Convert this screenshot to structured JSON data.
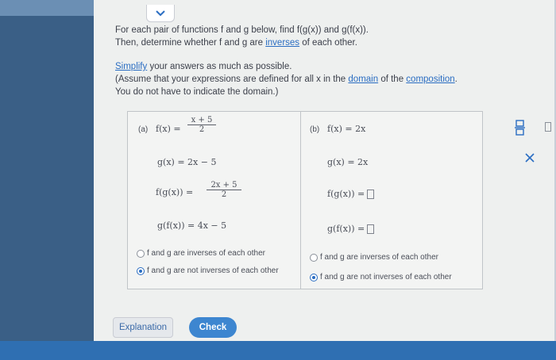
{
  "prompt": {
    "line1": "For each pair of functions f and g below, find f(g(x)) and g(f(x)).",
    "line2_pre": "Then, determine whether f and g are ",
    "line2_link": "inverses",
    "line2_post": " of each other.",
    "simplify_link": "Simplify",
    "simplify_rest": " your answers as much as possible.",
    "assume_pre": "(Assume that your expressions are defined for all x in the ",
    "domain_link": "domain",
    "assume_mid": " of the ",
    "composition_link": "composition",
    "assume_post": ".",
    "no_indicate": "You do not have to indicate the domain.)"
  },
  "part_a": {
    "label": "(a)",
    "f_lhs": "f(x) =",
    "f_num": "x + 5",
    "f_den": "2",
    "g_def": "g(x) = 2x − 5",
    "fg_lhs": "f(g(x)) =",
    "fg_num": "2x + 5",
    "fg_den": "2",
    "gf_def": "g(f(x)) = 4x − 5",
    "option_inverse": "f and g are inverses of each other",
    "option_not_inverse": "f and g are not inverses of each other",
    "selected": "not_inverse"
  },
  "part_b": {
    "label": "(b)",
    "f_def": "f(x) = 2x",
    "g_def": "g(x) = 2x",
    "fg_lhs": "f(g(x)) =",
    "gf_lhs": "g(f(x)) =",
    "option_inverse": "f and g are inverses of each other",
    "option_not_inverse": "f and g are not inverses of each other",
    "selected": "not_inverse"
  },
  "buttons": {
    "explanation": "Explanation",
    "check": "Check"
  },
  "icons": {
    "chevron": "chevron-down-icon",
    "fraction_tool": "fraction-tool-icon",
    "close": "close-icon"
  },
  "colors": {
    "accent": "#2a6dc2",
    "check_button": "#3d86d0"
  }
}
